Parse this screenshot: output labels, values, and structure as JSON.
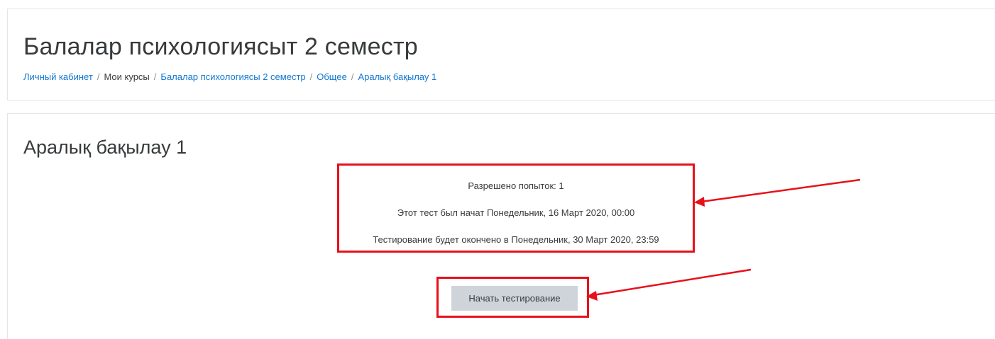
{
  "header": {
    "title": "Балалар психологиясыт 2 семестр",
    "breadcrumb": [
      {
        "label": "Личный кабинет",
        "link": true
      },
      {
        "label": "Мои курсы",
        "link": false
      },
      {
        "label": "Балалар психологиясы 2 семестр",
        "link": true
      },
      {
        "label": "Общее",
        "link": true
      },
      {
        "label": "Аралық бақылау 1",
        "link": true
      }
    ],
    "separator": "/"
  },
  "quiz": {
    "title": "Аралық бақылау 1",
    "attempts_allowed": "Разрешено попыток: 1",
    "opened": "Этот тест был начат Понедельник, 16 Март 2020, 00:00",
    "closes": "Тестирование будет окончено в Понедельник, 30 Март 2020, 23:59",
    "start_button_label": "Начать тестирование"
  },
  "colors": {
    "annotation": "#e8101a",
    "link": "#1177d1",
    "button_bg": "#ced4da",
    "text": "#373a3c"
  }
}
